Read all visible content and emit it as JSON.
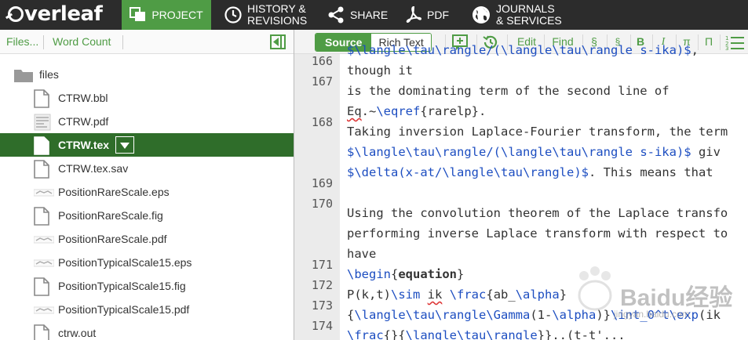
{
  "brand": {
    "logo_text": "verleaf"
  },
  "nav": {
    "project": "PROJECT",
    "history_line1": "HISTORY &",
    "history_line2": "REVISIONS",
    "share": "SHARE",
    "pdf": "PDF",
    "journals_line1": "JOURNALS",
    "journals_line2": "& SERVICES"
  },
  "file_toolbar": {
    "files": "Files...",
    "word_count": "Word Count"
  },
  "tree": {
    "folder": "files",
    "items": [
      {
        "name": "CTRW.bbl",
        "icon": "text-file-icon"
      },
      {
        "name": "CTRW.pdf",
        "icon": "pdf-file-icon"
      },
      {
        "name": "CTRW.tex",
        "icon": "text-file-icon",
        "selected": true
      },
      {
        "name": "CTRW.tex.sav",
        "icon": "text-file-icon"
      },
      {
        "name": "PositionRareScale.eps",
        "icon": "image-file-icon"
      },
      {
        "name": "PositionRareScale.fig",
        "icon": "text-file-icon"
      },
      {
        "name": "PositionRareScale.pdf",
        "icon": "image-file-icon"
      },
      {
        "name": "PositionTypicalScale15.eps",
        "icon": "image-file-icon"
      },
      {
        "name": "PositionTypicalScale15.fig",
        "icon": "text-file-icon"
      },
      {
        "name": "PositionTypicalScale15.pdf",
        "icon": "image-file-icon"
      },
      {
        "name": "ctrw.out",
        "icon": "text-file-icon"
      }
    ]
  },
  "editor_toolbar": {
    "source": "Source",
    "rich_text": "Rich Text",
    "edit": "Edit",
    "find": "Find",
    "section": "§",
    "subsection": "§",
    "bold": "B",
    "italic": "I",
    "pi_lower": "π",
    "pi_upper": "Π"
  },
  "code": {
    "line_numbers": [
      "166",
      "167",
      "168",
      "169",
      "170",
      "171",
      "172",
      "173",
      "174"
    ],
    "lines": [
      "$\\langle\\tau\\rangle/(\\langle\\tau\\rangle s-ika)$,",
      "though it",
      "is the dominating term of the second line of",
      "Eq.~\\eqref{rarelp}.",
      "Taking inversion Laplace-Fourier transform, the term",
      "$\\langle\\tau\\rangle/(\\langle\\tau\\rangle s-ika)$ giv",
      "$\\delta(x-at/\\langle\\tau\\rangle)$. This means that",
      "",
      "Using the convolution theorem of the Laplace transfo",
      "performing inverse Laplace transform with respect to",
      "have",
      "\\begin{equation}",
      "P(k,t)\\sim ik \\frac{ab_\\alpha}",
      "{\\langle\\tau\\rangle\\Gamma(1-\\alpha)}\\int_0^t\\exp(ik",
      "\\frac{}{\\langle\\tau\\rangle}}..(t-t'..."
    ]
  },
  "watermark": {
    "main": "Baidu经验",
    "sub": "jingyan.baidu.com"
  }
}
